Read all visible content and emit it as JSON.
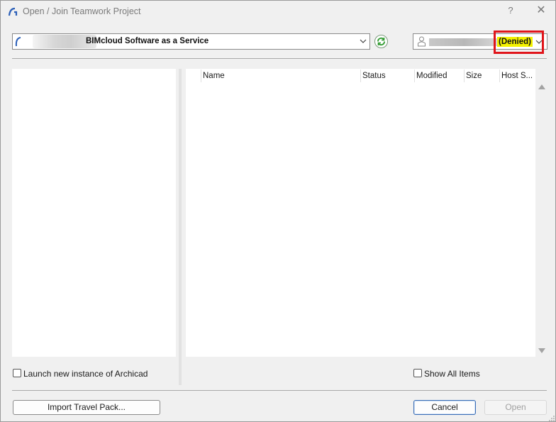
{
  "window": {
    "title": "Open / Join Teamwork Project",
    "help_label": "?",
    "close_label": "✕"
  },
  "server": {
    "selected": "BIMcloud Software as a Service"
  },
  "user": {
    "status": "(Denied)"
  },
  "list": {
    "columns": [
      "Name",
      "Status",
      "Modified",
      "Size",
      "Host S..."
    ]
  },
  "options": {
    "launch_new_instance": {
      "label": "Launch new instance of Archicad",
      "checked": false
    },
    "show_all_items": {
      "label": "Show All Items",
      "checked": false
    }
  },
  "buttons": {
    "import_travel_pack": "Import Travel Pack...",
    "cancel": "Cancel",
    "open": "Open"
  },
  "colors": {
    "highlight_box": "#e0151b",
    "denied_highlight": "#f5f200",
    "accent": "#3a6db5"
  },
  "icons": {
    "app": "archicad-logo-icon",
    "refresh": "refresh-icon",
    "user": "user-icon"
  }
}
